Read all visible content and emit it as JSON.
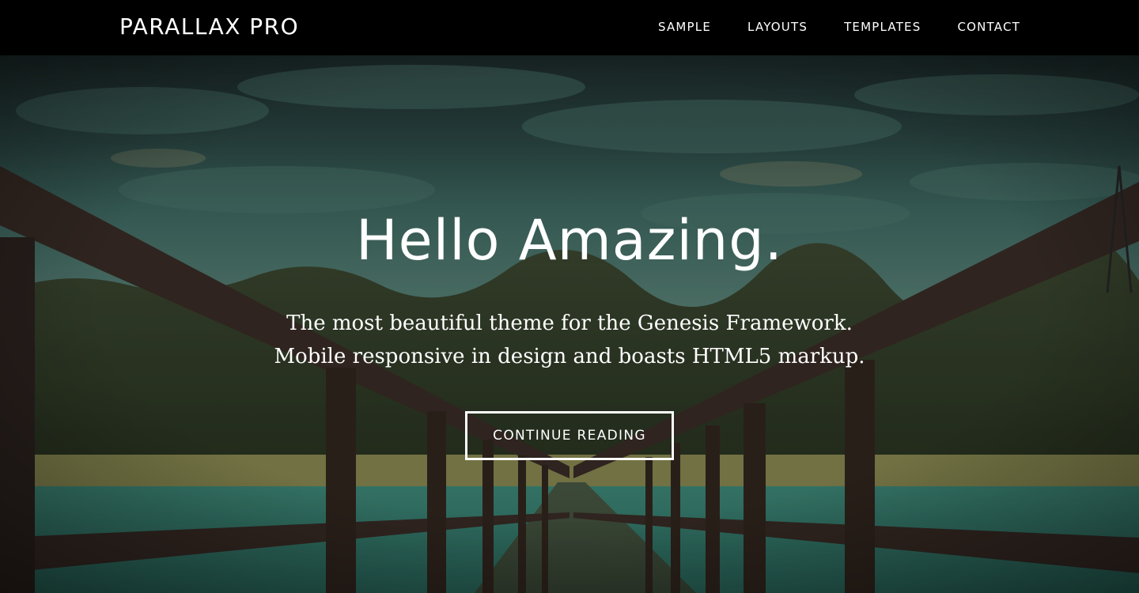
{
  "header": {
    "site_title": "PARALLAX PRO",
    "nav": [
      {
        "label": "SAMPLE"
      },
      {
        "label": "LAYOUTS"
      },
      {
        "label": "TEMPLATES"
      },
      {
        "label": "CONTACT"
      }
    ]
  },
  "hero": {
    "title": "Hello Amazing.",
    "description_line1": "The most beautiful theme for the Genesis Framework.",
    "description_line2": "Mobile responsive in design and boasts HTML5 markup.",
    "button_label": "CONTINUE READING",
    "background_image": "stormy-sky-wooden-pier-over-lake"
  },
  "colors": {
    "header_bg": "#000000",
    "text": "#ffffff"
  }
}
